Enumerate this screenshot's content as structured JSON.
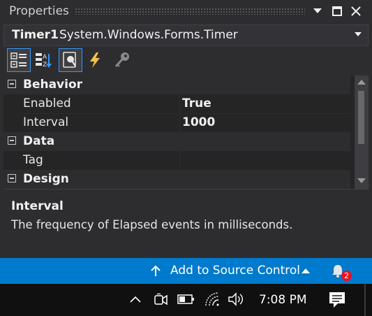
{
  "panel": {
    "title": "Properties"
  },
  "object_selector": {
    "name": "Timer1",
    "type": "System.Windows.Forms.Timer"
  },
  "toolbar": {
    "buttons": [
      {
        "icon": "categorized-icon",
        "selected": true
      },
      {
        "icon": "alphabetical-icon",
        "selected": false
      },
      {
        "icon": "properties-icon",
        "selected": true
      },
      {
        "icon": "events-lightning-icon",
        "selected": false
      },
      {
        "icon": "property-pages-key-icon",
        "selected": false
      }
    ]
  },
  "grid": {
    "categories": [
      {
        "name": "Behavior",
        "expanded": true,
        "properties": [
          {
            "name": "Enabled",
            "value": "True"
          },
          {
            "name": "Interval",
            "value": "1000"
          }
        ]
      },
      {
        "name": "Data",
        "expanded": true,
        "properties": [
          {
            "name": "Tag",
            "value": ""
          }
        ]
      },
      {
        "name": "Design",
        "expanded": true,
        "properties": []
      }
    ]
  },
  "description": {
    "title": "Interval",
    "text": "The frequency of Elapsed events in milliseconds."
  },
  "statusbar": {
    "source_control_label": "Add to Source Control",
    "notification_count": "2",
    "color": "#007acc"
  },
  "taskbar": {
    "time": "7:08 PM"
  },
  "colors": {
    "accent": "#3399ff",
    "badge": "#e81123"
  }
}
